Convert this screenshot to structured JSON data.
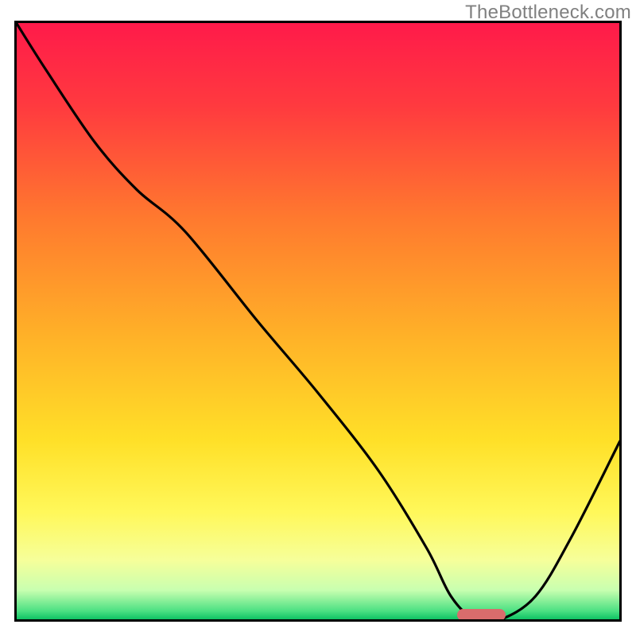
{
  "watermark": "TheBottleneck.com",
  "chart_data": {
    "type": "line",
    "title": "",
    "xlabel": "",
    "ylabel": "",
    "xlim": [
      0,
      100
    ],
    "ylim": [
      0,
      100
    ],
    "x": [
      0,
      5,
      13,
      20,
      28,
      40,
      50,
      60,
      68,
      72,
      76,
      80,
      86,
      92,
      100
    ],
    "y": [
      100,
      92,
      80,
      72,
      65,
      50,
      38,
      25,
      12,
      4,
      0,
      0,
      4,
      14,
      30
    ],
    "marker": {
      "x": 77,
      "y": 0,
      "width": 8
    },
    "gradient_stops": [
      {
        "offset": 0.0,
        "color": "#ff1a4a"
      },
      {
        "offset": 0.14,
        "color": "#ff3a3f"
      },
      {
        "offset": 0.33,
        "color": "#ff7a2e"
      },
      {
        "offset": 0.52,
        "color": "#ffb028"
      },
      {
        "offset": 0.7,
        "color": "#ffe028"
      },
      {
        "offset": 0.82,
        "color": "#fff85a"
      },
      {
        "offset": 0.9,
        "color": "#f6ff9a"
      },
      {
        "offset": 0.95,
        "color": "#c8ffb0"
      },
      {
        "offset": 0.985,
        "color": "#4be082"
      },
      {
        "offset": 1.0,
        "color": "#08c060"
      }
    ]
  },
  "plot": {
    "inner_left": 20,
    "inner_top": 28,
    "inner_width": 760,
    "inner_height": 752
  }
}
